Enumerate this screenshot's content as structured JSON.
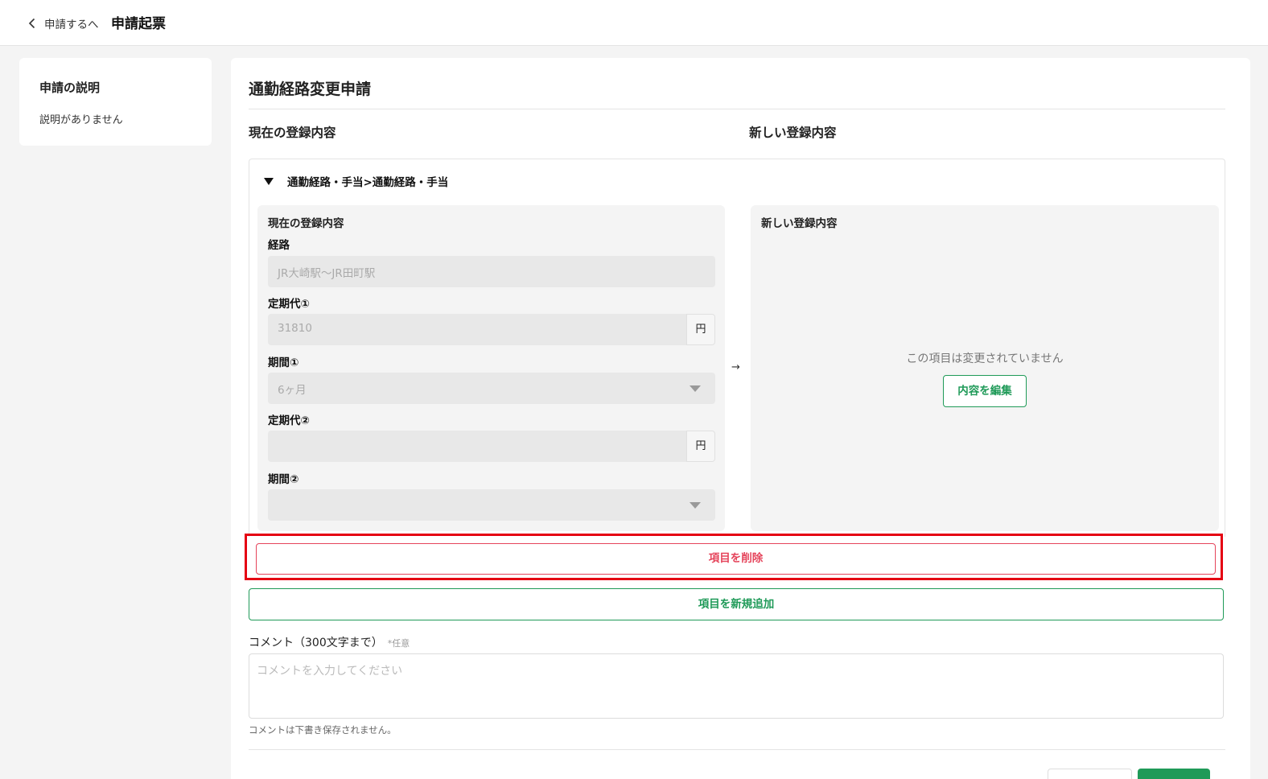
{
  "header": {
    "back_label": "申請するへ",
    "title": "申請起票"
  },
  "sidebar": {
    "title": "申請の説明",
    "text": "説明がありません"
  },
  "form": {
    "title": "通勤経路変更申請",
    "col_current": "現在の登録内容",
    "col_new": "新しい登録内容",
    "section_title": "通勤経路・手当>通勤経路・手当",
    "current_panel": {
      "title": "現在の登録内容",
      "route_label": "経路",
      "route_value": "JR大崎駅〜JR田町駅",
      "fare1_label": "定期代①",
      "fare1_value": "31810",
      "unit": "円",
      "period1_label": "期間①",
      "period1_value": "6ヶ月",
      "fare2_label": "定期代②",
      "fare2_value": "",
      "period2_label": "期間②",
      "period2_value": ""
    },
    "arrow": "→",
    "new_panel": {
      "title": "新しい登録内容",
      "no_change_text": "この項目は変更されていません",
      "edit_button": "内容を編集"
    },
    "delete_button": "項目を削除",
    "add_button": "項目を新規追加",
    "comment": {
      "label": "コメント（300文字まで）",
      "optional": "*任意",
      "placeholder": "コメントを入力してください",
      "note": "コメントは下書き保存されません。"
    }
  },
  "colors": {
    "accent_green": "#1f9a58",
    "danger_red": "#e5445b",
    "highlight_red": "#e50012"
  }
}
